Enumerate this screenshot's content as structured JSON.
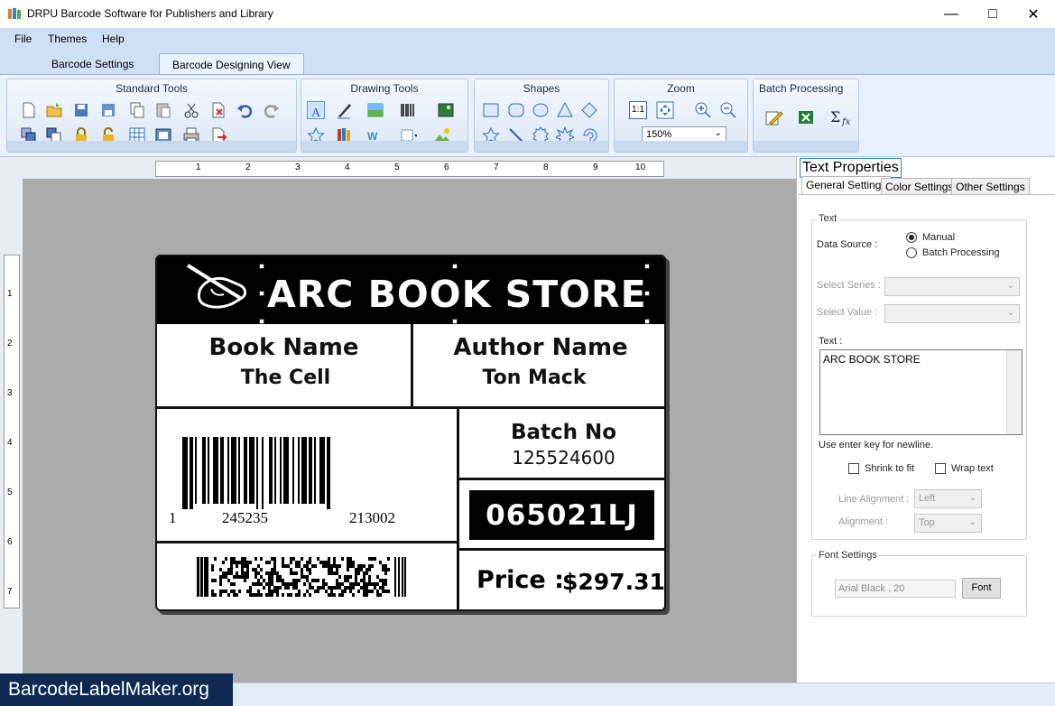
{
  "window": {
    "title": "DRPU Barcode Software for Publishers and Library"
  },
  "menu": [
    "File",
    "Themes",
    "Help"
  ],
  "tabs": [
    {
      "label": "Barcode Settings",
      "active": false
    },
    {
      "label": "Barcode Designing View",
      "active": true
    }
  ],
  "ribbon": {
    "standard_tools": "Standard Tools",
    "drawing_tools": "Drawing Tools",
    "shapes": "Shapes",
    "zoom": "Zoom",
    "zoom_value": "150%",
    "zoom_1to1": "1:1",
    "batch_processing": "Batch Processing"
  },
  "rulers": {
    "horizontal": [
      "1",
      "2",
      "3",
      "4",
      "5",
      "6",
      "7",
      "8",
      "9",
      "10"
    ],
    "vertical": [
      "1",
      "2",
      "3",
      "4",
      "5",
      "6",
      "7"
    ]
  },
  "label": {
    "store_name": "ARC BOOK STORE",
    "book_name_title": "Book Name",
    "book_name_value": "The Cell",
    "author_title": "Author Name",
    "author_value": "Ton Mack",
    "batch_title": "Batch No",
    "batch_value": "125524600",
    "code": "065021LJ",
    "price_title": "Price :",
    "price_value": "$297.31",
    "barcode_digits": [
      "1",
      "245235",
      "213002"
    ]
  },
  "panel": {
    "title": "Text Properties",
    "tabs": [
      "General Settings",
      "Color Settings",
      "Other Settings"
    ],
    "text_group": "Text",
    "data_source_label": "Data Source :",
    "data_source_options": [
      "Manual",
      "Batch Processing"
    ],
    "select_series_label": "Select Series :",
    "select_value_label": "Select Value :",
    "text_label": "Text :",
    "text_value": "ARC BOOK STORE",
    "hint": "Use enter key for newline.",
    "shrink_to_fit": "Shrink to fit",
    "wrap_text": "Wrap text",
    "line_alignment_label": "Line Alignment :",
    "line_alignment_value": "Left",
    "alignment_label": "Alignment :",
    "alignment_value": "Top",
    "font_settings": "Font Settings",
    "font_value": "Arial Black , 20",
    "font_button": "Font"
  },
  "watermark": "BarcodeLabelMaker.org",
  "colors": {
    "ribbon_bg": "#e9f1fa",
    "menu_bg": "#cfe0f4",
    "canvas_bg": "#ababab",
    "watermark_bg": "#0e2a52"
  }
}
